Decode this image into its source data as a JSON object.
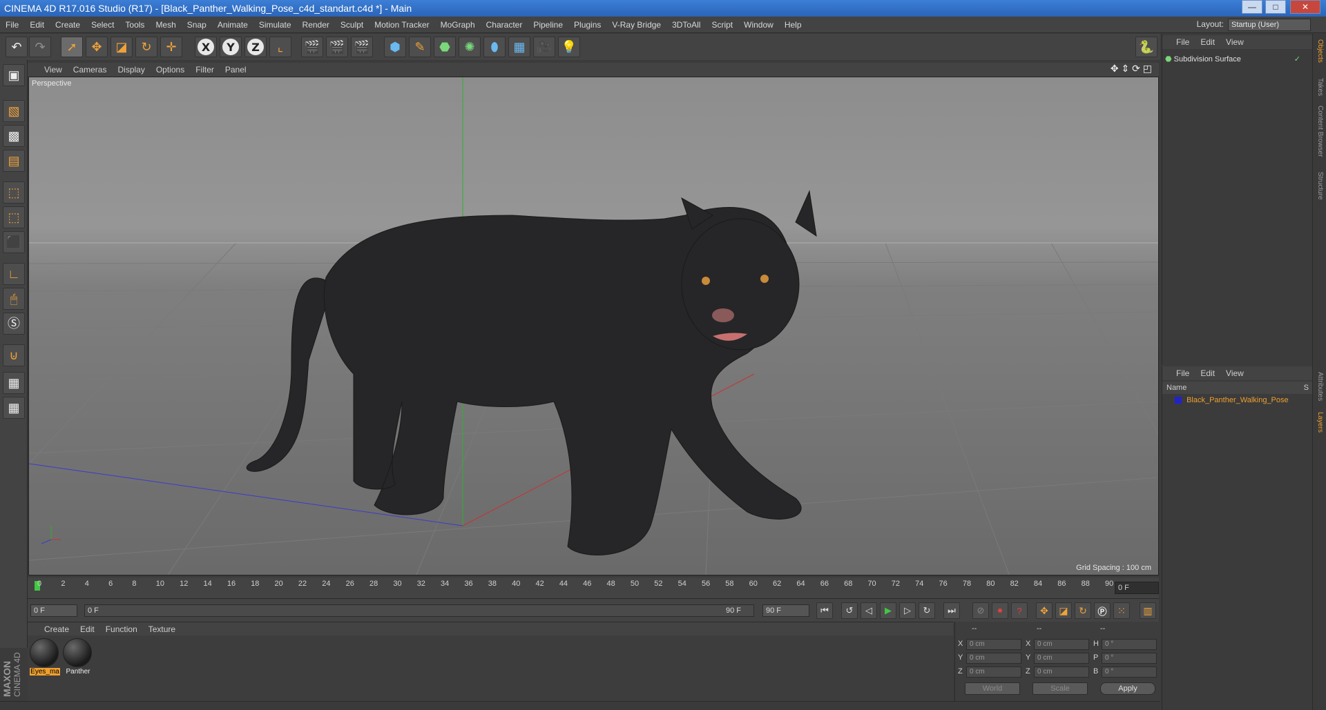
{
  "window": {
    "title": "CINEMA 4D R17.016 Studio (R17) - [Black_Panther_Walking_Pose_c4d_standart.c4d *] - Main",
    "minimize": "—",
    "maximize": "□",
    "close": "✕"
  },
  "menu": [
    "File",
    "Edit",
    "Create",
    "Select",
    "Tools",
    "Mesh",
    "Snap",
    "Animate",
    "Simulate",
    "Render",
    "Sculpt",
    "Motion Tracker",
    "MoGraph",
    "Character",
    "Pipeline",
    "Plugins",
    "V-Ray Bridge",
    "3DToAll",
    "Script",
    "Window",
    "Help"
  ],
  "layout": {
    "label": "Layout:",
    "value": "Startup (User)"
  },
  "axes": {
    "x": "X",
    "y": "Y",
    "z": "Z"
  },
  "viewport": {
    "menu": [
      "View",
      "Cameras",
      "Display",
      "Options",
      "Filter",
      "Panel"
    ],
    "label": "Perspective",
    "grid_spacing": "Grid Spacing : 100 cm"
  },
  "timeline": {
    "ticks": [
      "0",
      "2",
      "4",
      "6",
      "8",
      "10",
      "12",
      "14",
      "16",
      "18",
      "20",
      "22",
      "24",
      "26",
      "28",
      "30",
      "32",
      "34",
      "36",
      "38",
      "40",
      "42",
      "44",
      "46",
      "48",
      "50",
      "52",
      "54",
      "56",
      "58",
      "60",
      "62",
      "64",
      "66",
      "68",
      "70",
      "72",
      "74",
      "76",
      "78",
      "80",
      "82",
      "84",
      "86",
      "88",
      "90"
    ],
    "current_frame": "0 F",
    "start_field": "0 F",
    "range_left": "0 F",
    "range_right": "90 F",
    "end_field": "90 F"
  },
  "material_manager": {
    "menu": [
      "Create",
      "Edit",
      "Function",
      "Texture"
    ],
    "materials": [
      {
        "name": "Eyes_ma",
        "selected": true
      },
      {
        "name": "Panther",
        "selected": false
      }
    ]
  },
  "coordinates": {
    "header": [
      "--",
      "--",
      "--"
    ],
    "rows": [
      {
        "l1": "X",
        "v1": "0 cm",
        "l2": "X",
        "v2": "0 cm",
        "l3": "H",
        "v3": "0 °"
      },
      {
        "l1": "Y",
        "v1": "0 cm",
        "l2": "Y",
        "v2": "0 cm",
        "l3": "P",
        "v3": "0 °"
      },
      {
        "l1": "Z",
        "v1": "0 cm",
        "l2": "Z",
        "v2": "0 cm",
        "l3": "B",
        "v3": "0 °"
      }
    ],
    "mode": "World",
    "scale": "Scale",
    "apply": "Apply"
  },
  "objects_panel": {
    "menu": [
      "File",
      "Edit",
      "View"
    ],
    "item": "Subdivision Surface"
  },
  "layers_panel": {
    "menu": [
      "File",
      "Edit",
      "View"
    ],
    "col_name": "Name",
    "col_s": "S",
    "item": "Black_Panther_Walking_Pose"
  },
  "side_tabs": [
    "Objects",
    "Takes",
    "Content Browser",
    "Structure",
    "Attributes",
    "Layers"
  ],
  "branding": {
    "maxon": "MAXON",
    "cinema": "CINEMA 4D"
  },
  "colors": {
    "accent": "#f0a030",
    "title_blue": "#2f6fc8",
    "viewport_bg": "#7f7f7f"
  }
}
